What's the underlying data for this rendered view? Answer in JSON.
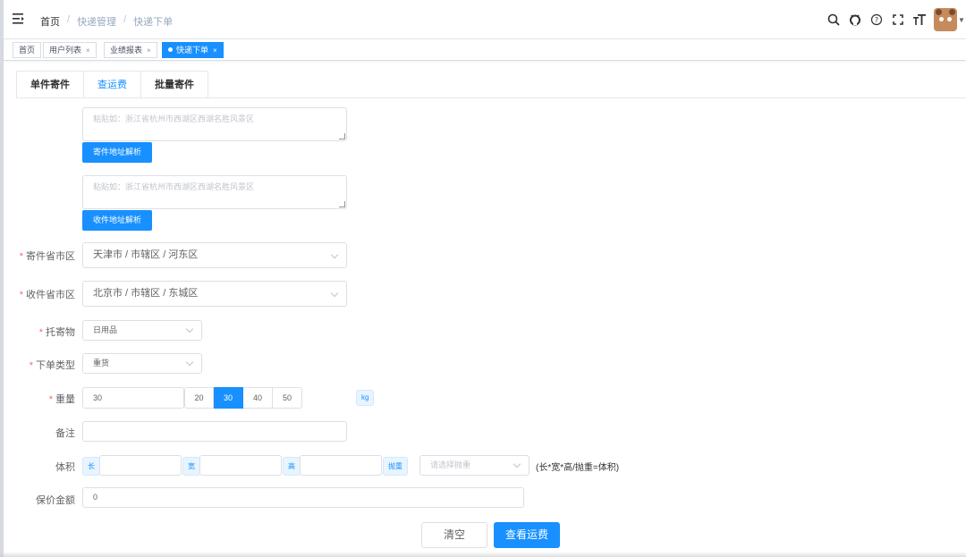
{
  "navbar": {
    "breadcrumb": [
      "首页",
      "快递管理",
      "快递下单"
    ],
    "separator": "/"
  },
  "tags": [
    {
      "label": "首页",
      "closable": false
    },
    {
      "label": "用户列表",
      "closable": true
    },
    {
      "label": "业绩报表",
      "closable": true
    },
    {
      "label": "快递下单",
      "closable": true,
      "active": true
    }
  ],
  "tag_close": "×",
  "tabs": [
    "单件寄件",
    "查运费",
    "批量寄件"
  ],
  "active_tab": "查运费",
  "sender": {
    "address_placeholder": "粘贴如：浙江省杭州市西湖区西湖名胜风景区",
    "parse_button": "寄件地址解析"
  },
  "receiver": {
    "address_placeholder": "粘贴如：浙江省杭州市西湖区西湖名胜风景区",
    "parse_button": "收件地址解析"
  },
  "form": {
    "required_mark": "*",
    "sender_region_label": "寄件省市区",
    "sender_region_value": "天津市 / 市辖区 / 河东区",
    "receiver_region_label": "收件省市区",
    "receiver_region_value": "北京市 / 市辖区 / 东城区",
    "goods_label": "托寄物",
    "goods_value": "日用品",
    "order_type_label": "下单类型",
    "order_type_value": "重货",
    "weight_label": "重量",
    "weight_value": "30",
    "weight_options": [
      "20",
      "30",
      "40",
      "50"
    ],
    "weight_selected": "30",
    "weight_unit": "kg",
    "remark_label": "备注",
    "volume_label": "体积",
    "length_prefix": "长",
    "width_prefix": "宽",
    "height_prefix": "高",
    "throw_prefix": "抛重",
    "throw_placeholder": "请选择抛重",
    "volume_hint": "(长*宽*高/抛重=体积)",
    "insured_label": "保价金额",
    "insured_value": "0"
  },
  "actions": {
    "clear": "清空",
    "check_fee": "查看运费"
  }
}
